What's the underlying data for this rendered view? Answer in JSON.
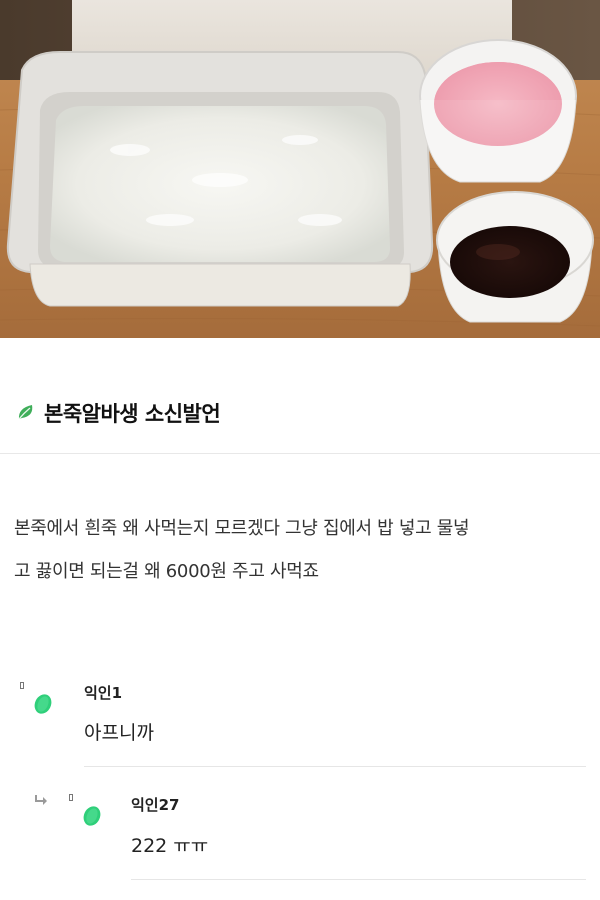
{
  "post": {
    "title": "본죽알바생 소신발언",
    "body_lines": [
      "본죽에서 흰죽 왜 사먹는지 모르겠다 그냥 집에서 밥 넣고 물넣",
      "고 끓이면 되는걸 왜 6000원 주고 사먹죠"
    ]
  },
  "comments": [
    {
      "author": "익인1",
      "text": "아프니까",
      "is_reply": false
    },
    {
      "author": "익인27",
      "text": "222 ㅠㅠ",
      "is_reply": true
    }
  ],
  "colors": {
    "leaf": "#3fae5a",
    "avatar": "#2fcf7a",
    "divider": "#e6e6e6"
  }
}
